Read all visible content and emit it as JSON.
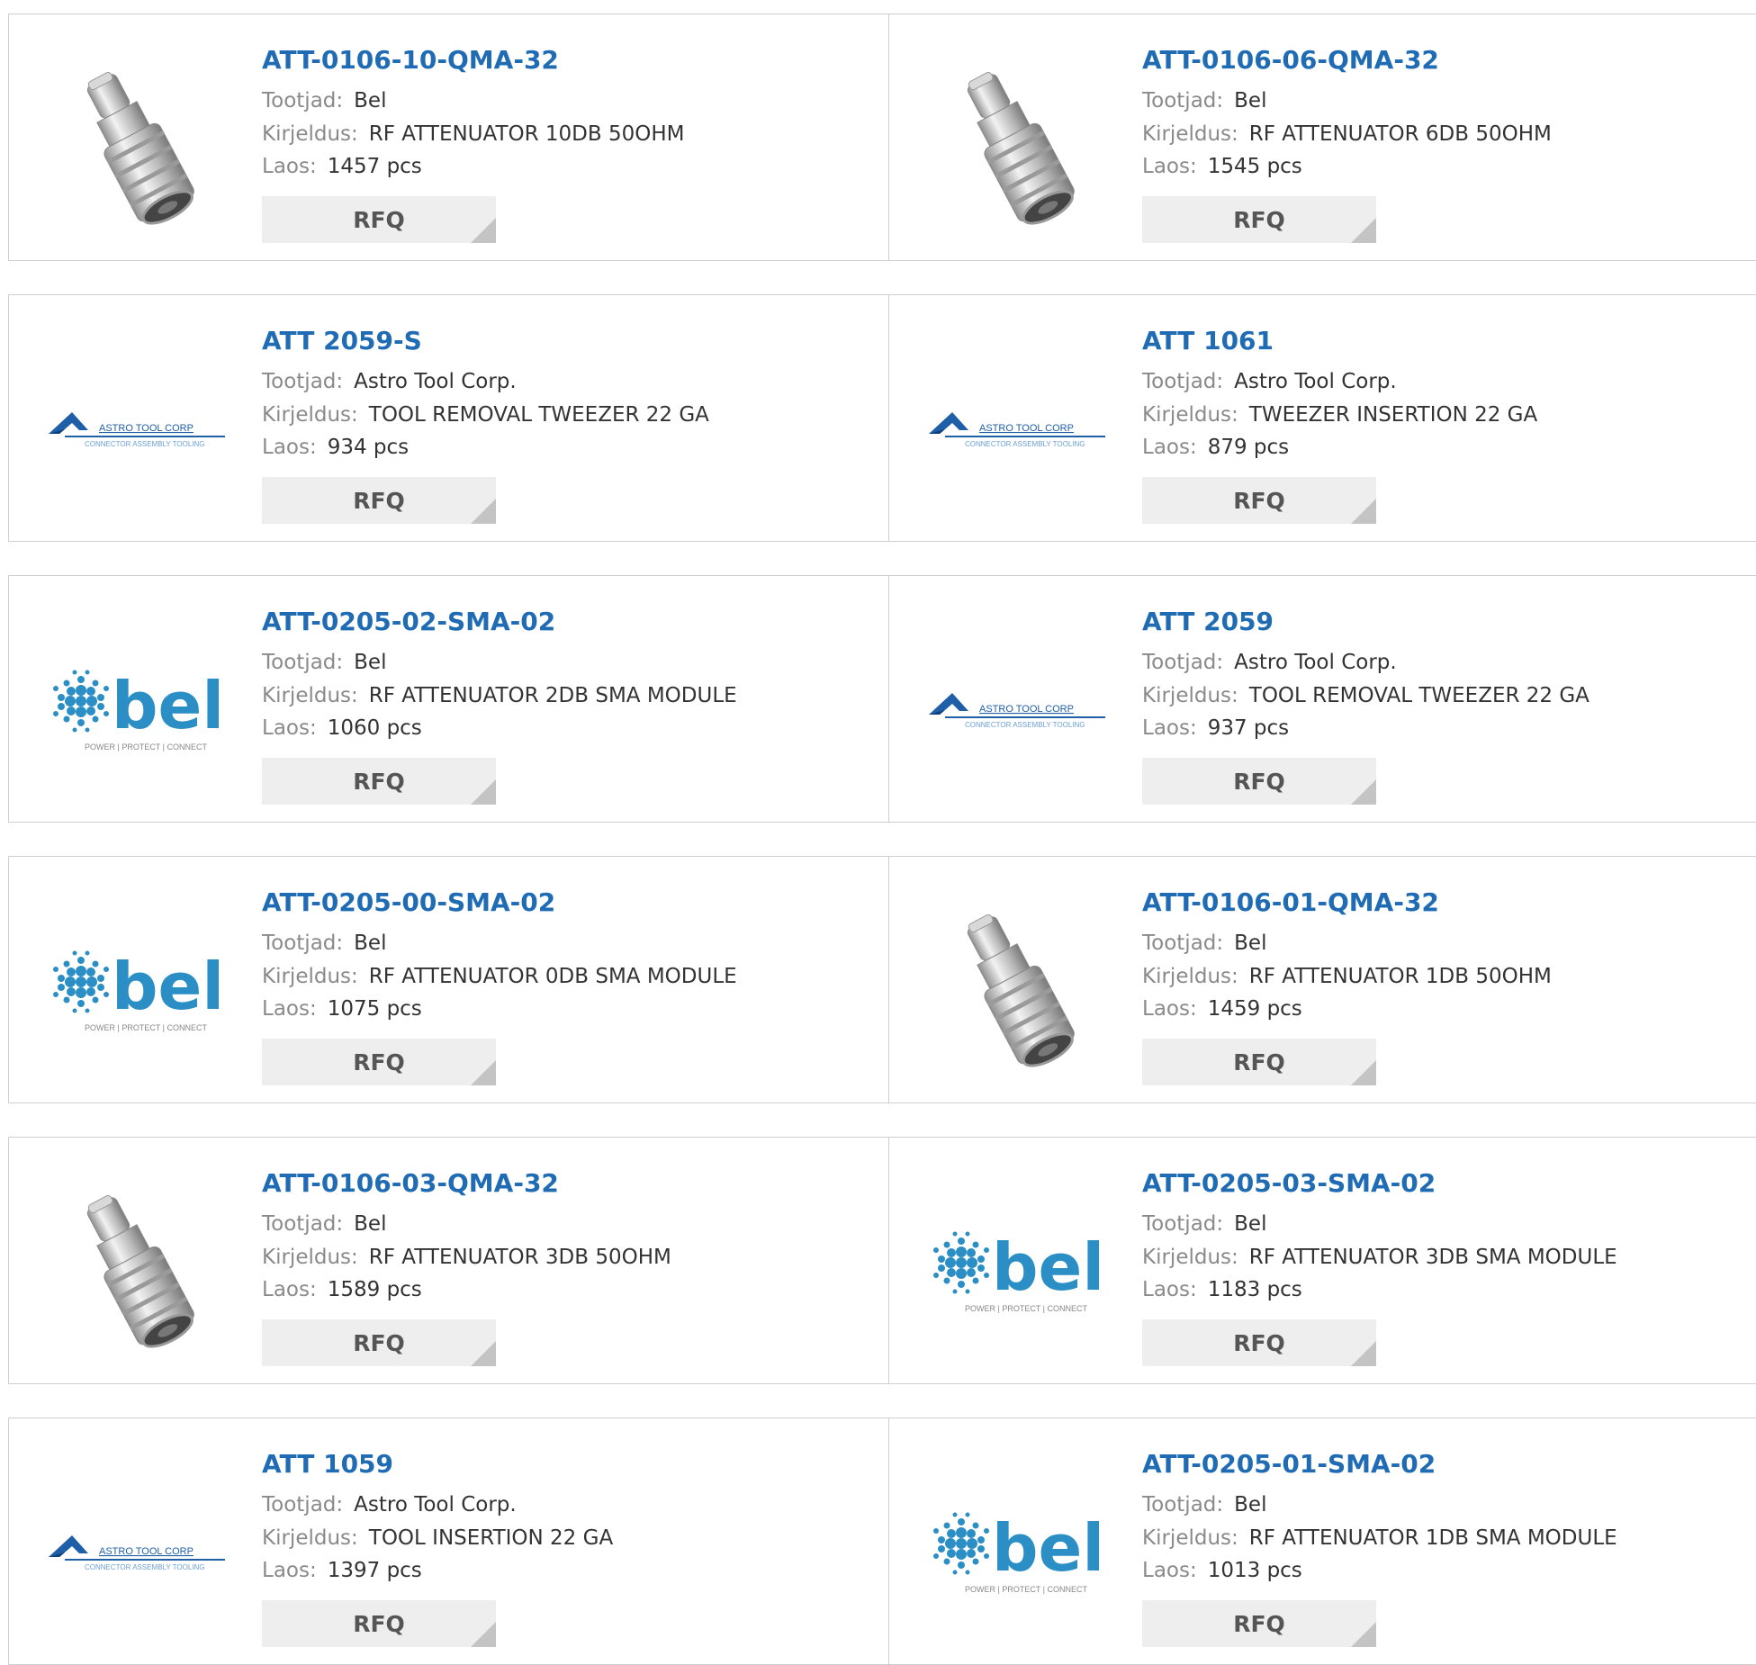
{
  "labels": {
    "manufacturer": "Tootjad:",
    "description": "Kirjeldus:",
    "stock": "Laos:",
    "rfq": "RFQ"
  },
  "rows": [
    [
      {
        "part": "ATT-0106-10-QMA-32",
        "manufacturer": "Bel",
        "description": "RF ATTENUATOR 10DB 50OHM",
        "stock": "1457 pcs",
        "image": "connector"
      },
      {
        "part": "ATT-0106-06-QMA-32",
        "manufacturer": "Bel",
        "description": "RF ATTENUATOR 6DB 50OHM",
        "stock": "1545 pcs",
        "image": "connector"
      }
    ],
    [
      {
        "part": "ATT 2059-S",
        "manufacturer": "Astro Tool Corp.",
        "description": "TOOL REMOVAL TWEEZER 22 GA",
        "stock": "934 pcs",
        "image": "astro-logo"
      },
      {
        "part": "ATT 1061",
        "manufacturer": "Astro Tool Corp.",
        "description": "TWEEZER INSERTION 22 GA",
        "stock": "879 pcs",
        "image": "astro-logo"
      }
    ],
    [
      {
        "part": "ATT-0205-02-SMA-02",
        "manufacturer": "Bel",
        "description": "RF ATTENUATOR 2DB SMA MODULE",
        "stock": "1060 pcs",
        "image": "bel-logo"
      },
      {
        "part": "ATT 2059",
        "manufacturer": "Astro Tool Corp.",
        "description": "TOOL REMOVAL TWEEZER 22 GA",
        "stock": "937 pcs",
        "image": "astro-logo"
      }
    ],
    [
      {
        "part": "ATT-0205-00-SMA-02",
        "manufacturer": "Bel",
        "description": "RF ATTENUATOR 0DB SMA MODULE",
        "stock": "1075 pcs",
        "image": "bel-logo"
      },
      {
        "part": "ATT-0106-01-QMA-32",
        "manufacturer": "Bel",
        "description": "RF ATTENUATOR 1DB 50OHM",
        "stock": "1459 pcs",
        "image": "connector"
      }
    ],
    [
      {
        "part": "ATT-0106-03-QMA-32",
        "manufacturer": "Bel",
        "description": "RF ATTENUATOR 3DB 50OHM",
        "stock": "1589 pcs",
        "image": "connector"
      },
      {
        "part": "ATT-0205-03-SMA-02",
        "manufacturer": "Bel",
        "description": "RF ATTENUATOR 3DB SMA MODULE",
        "stock": "1183 pcs",
        "image": "bel-logo"
      }
    ],
    [
      {
        "part": "ATT 1059",
        "manufacturer": "Astro Tool Corp.",
        "description": "TOOL INSERTION 22 GA",
        "stock": "1397 pcs",
        "image": "astro-logo"
      },
      {
        "part": "ATT-0205-01-SMA-02",
        "manufacturer": "Bel",
        "description": "RF ATTENUATOR 1DB SMA MODULE",
        "stock": "1013 pcs",
        "image": "bel-logo"
      }
    ]
  ],
  "logo_text": {
    "astro_name": "ASTRO TOOL CORP",
    "astro_tagline": "CONNECTOR ASSEMBLY TOOLING",
    "bel_name": "bel",
    "bel_tagline": "POWER | PROTECT | CONNECT"
  },
  "colors": {
    "title": "#1f6bb4",
    "label": "#8a8a8a",
    "button_bg": "#eeeeee",
    "bel_blue": "#2b8fc6",
    "astro_blue": "#1f5fa8",
    "border": "#cfcfcf"
  }
}
